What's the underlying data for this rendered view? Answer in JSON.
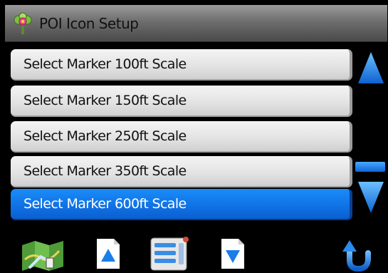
{
  "header": {
    "title": "POI Icon Setup",
    "app_icon": "poi-setup-icon"
  },
  "list": {
    "items": [
      {
        "label": "Select Marker 100ft Scale",
        "selected": false
      },
      {
        "label": "Select Marker 150ft Scale",
        "selected": false
      },
      {
        "label": "Select Marker 250ft Scale",
        "selected": false
      },
      {
        "label": "Select Marker 350ft Scale",
        "selected": false
      },
      {
        "label": "Select Marker 600ft Scale",
        "selected": true
      }
    ]
  },
  "scrollbar": {
    "up_icon": "triangle-up-icon",
    "down_icon": "triangle-down-icon"
  },
  "toolbar": {
    "buttons": [
      "map-icon",
      "page-up-icon",
      "list-menu-icon",
      "page-down-icon",
      "back-arrow-icon"
    ]
  },
  "colors": {
    "accent": "#1073e6",
    "item_bg": "#e2e2e2",
    "background": "#000000"
  }
}
